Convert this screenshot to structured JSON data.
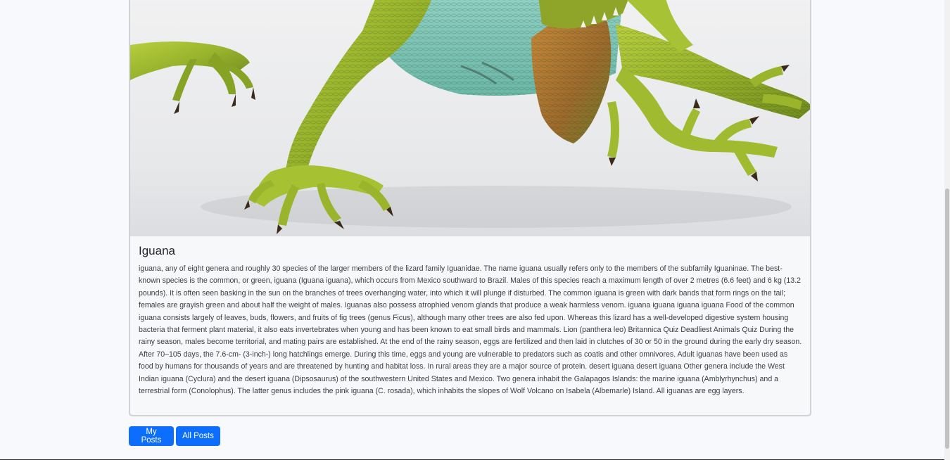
{
  "post": {
    "image_alt": "Green iguana photo",
    "title": "Iguana",
    "body": "iguana, any of eight genera and roughly 30 species of the larger members of the lizard family Iguanidae. The name iguana usually refers only to the members of the subfamily Iguaninae. The best-known species is the common, or green, iguana (Iguana iguana), which occurs from Mexico southward to Brazil. Males of this species reach a maximum length of over 2 metres (6.6 feet) and 6 kg (13.2 pounds). It is often seen basking in the sun on the branches of trees overhanging water, into which it will plunge if disturbed. The common iguana is green with dark bands that form rings on the tail; females are grayish green and about half the weight of males. Iguanas also possess atrophied venom glands that produce a weak harmless venom. iguana iguana iguana iguana Food of the common iguana consists largely of leaves, buds, flowers, and fruits of fig trees (genus Ficus), although many other trees are also fed upon. Whereas this lizard has a well-developed digestive system housing bacteria that ferment plant material, it also eats invertebrates when young and has been known to eat small birds and mammals. Lion (panthera leo) Britannica Quiz Deadliest Animals Quiz During the rainy season, males become territorial, and mating pairs are established. At the end of the rainy season, eggs are fertilized and then laid in clutches of 30 or 50 in the ground during the early dry season. After 70–105 days, the 7.6-cm- (3-inch-) long hatchlings emerge. During this time, eggs and young are vulnerable to predators such as coatis and other omnivores. Adult iguanas have been used as food by humans for thousands of years and are threatened by hunting and habitat loss. In rural areas they are a major source of protein. desert iguana desert iguana Other genera include the West Indian iguana (Cyclura) and the desert iguana (Dipsosaurus) of the southwestern United States and Mexico. Two genera inhabit the Galapagos Islands: the marine iguana (Amblyrhynchus) and a terrestrial form (Conolophus). The latter genus includes the pink iguana (C. rosada), which inhabits the slopes of Wolf Volcano on Isabela (Albemarle) Island. All iguanas are egg layers."
  },
  "actions": {
    "my_posts_label": "My Posts",
    "all_posts_label": "All Posts"
  },
  "colors": {
    "primary": "#0d6efd",
    "background": "#f7f9fc",
    "card_border": "#cfd3d8"
  }
}
